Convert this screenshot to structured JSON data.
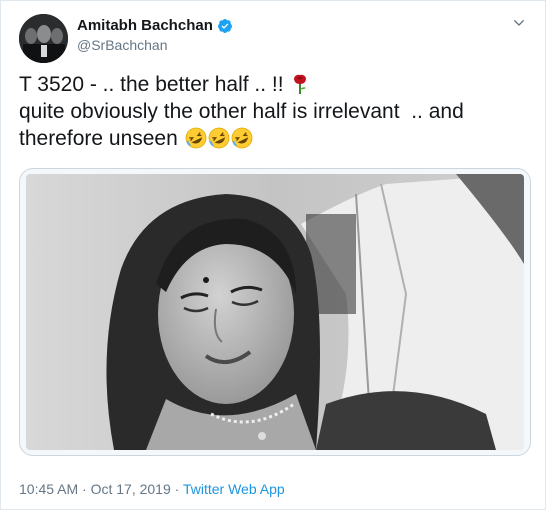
{
  "tweet": {
    "author_name": "Amitabh Bachchan",
    "author_handle": "@SrBachchan",
    "text_line1": "T 3520 - .. the better half .. !! ",
    "text_line2": "quite obviously the other half is irrelevant  .. and",
    "text_line3": "therefore unseen ",
    "emojis": [
      "rose-emoji",
      "rolling-on-floor-laughing-emoji",
      "rolling-on-floor-laughing-emoji",
      "rolling-on-floor-laughing-emoji"
    ],
    "timestamp": "10:45 AM · Oct 17, 2019",
    "separator": " · ",
    "source": "Twitter Web App",
    "verified": true
  },
  "colors": {
    "accent": "#1b95e0",
    "verified_badge": "#1da1f2",
    "secondary_text": "#657786",
    "border": "#e1e8ed"
  },
  "icons": {
    "verified": "verified-badge-icon",
    "menu": "chevron-down-icon"
  }
}
